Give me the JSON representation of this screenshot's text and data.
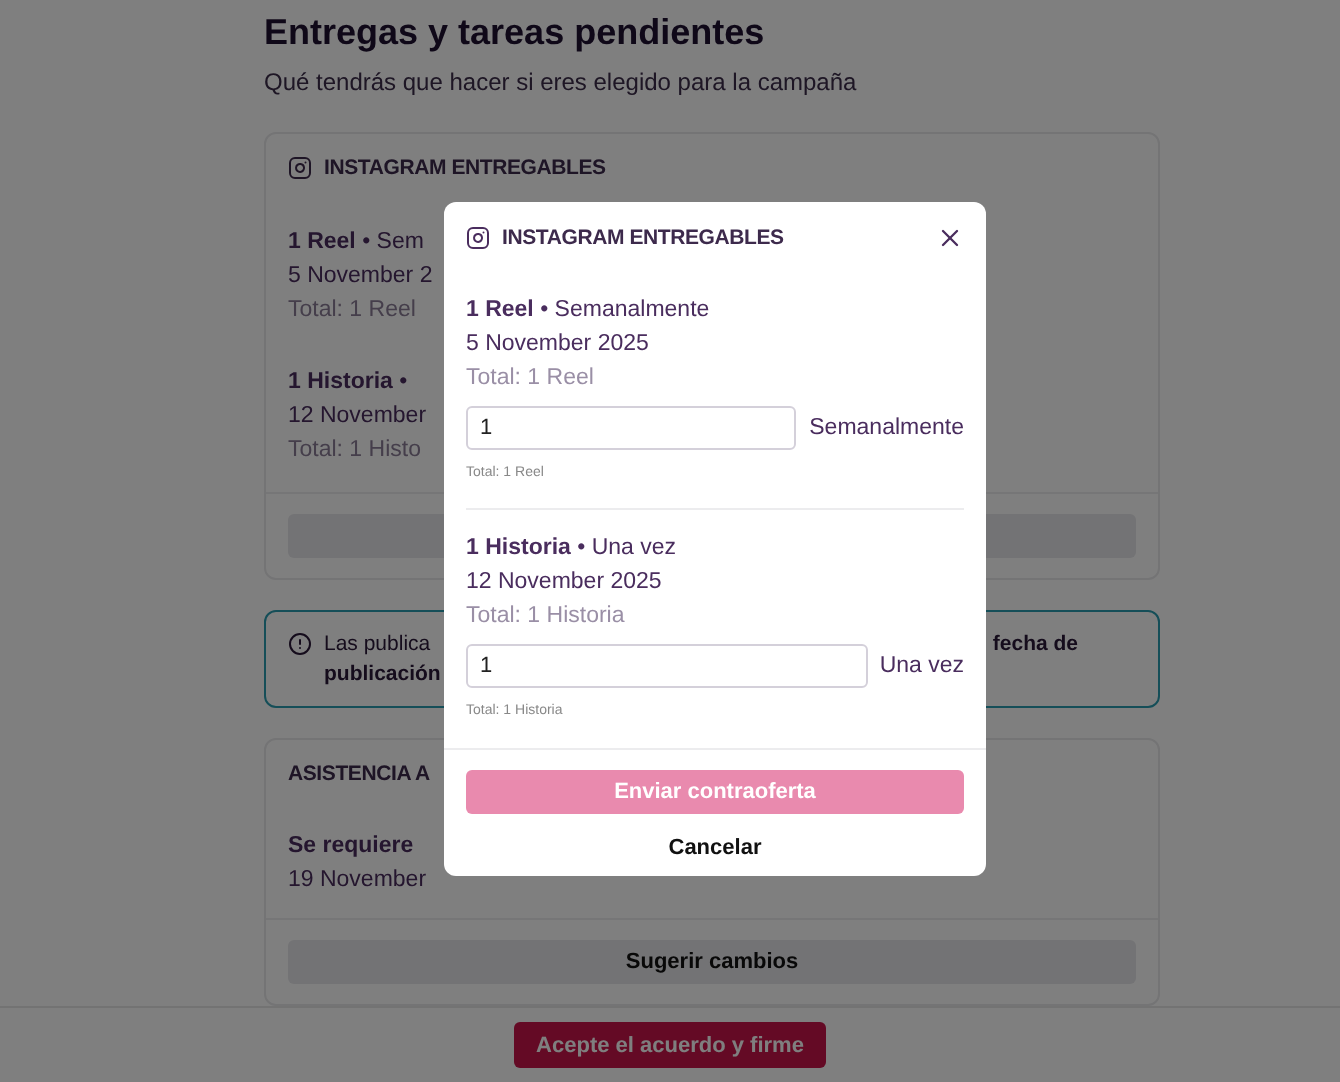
{
  "page": {
    "title": "Entregas y tareas pendientes",
    "subtitle": "Qué tendrás que hacer si eres elegido para la campaña"
  },
  "instagram_card": {
    "title": "INSTAGRAM ENTREGABLES",
    "deliverables": [
      {
        "heading": "**1 Reel** • Sem",
        "date": "5 November 2",
        "total": "Total: 1 Reel"
      },
      {
        "heading": "**1 Historia** •",
        "date": "12 November",
        "total": "Total: 1 Histo"
      }
    ]
  },
  "notice": {
    "line_start": "Las publica",
    "line_end": "fecha de",
    "line_2": "publicación"
  },
  "event_card": {
    "title": "ASISTENCIA A",
    "requirement": "Se requiere",
    "date": "19 November",
    "button": "Sugerir cambios"
  },
  "footer": {
    "button": "Acepte el acuerdo y firme"
  },
  "modal": {
    "title": "INSTAGRAM ENTREGABLES",
    "deliverables": [
      {
        "heading": "**1 Reel** • Semanalmente",
        "date": "5 November 2025",
        "total": "Total: 1 Reel",
        "quantity": "1",
        "frequency": "Semanalmente",
        "hint": "Total: 1 Reel"
      },
      {
        "heading": "**1 Historia** • Una vez",
        "date": "12 November 2025",
        "total": "Total: 1 Historia",
        "quantity": "1",
        "frequency": "Una vez",
        "hint": "Total: 1 Historia"
      }
    ],
    "submit": {
      "label": "Enviar contraoferta",
      "disabled": true
    },
    "cancel": "Cancelar"
  }
}
